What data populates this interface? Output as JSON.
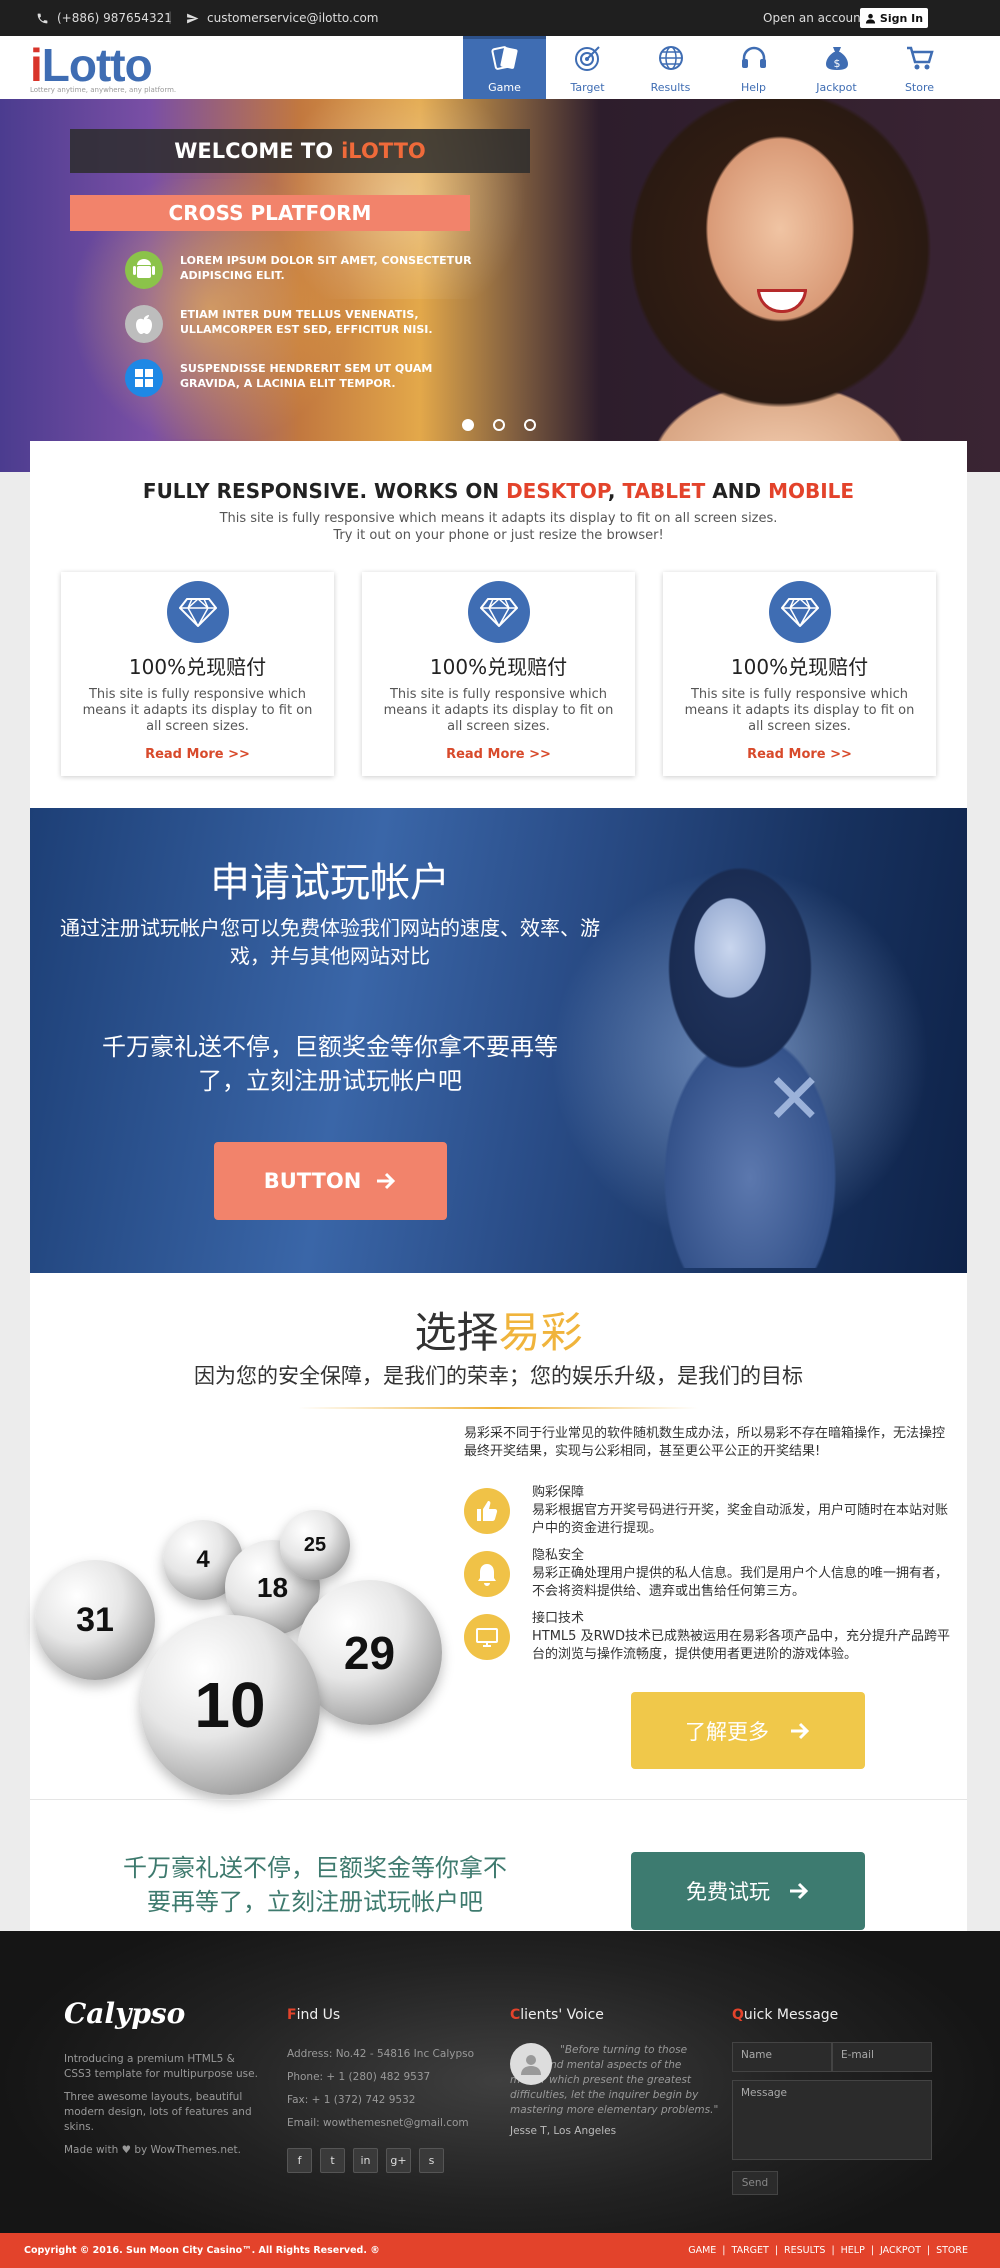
{
  "topbar": {
    "phone": "(+886) 987654321",
    "separator": "|",
    "email": "customerservice@ilotto.com",
    "open_account": "Open an account",
    "sign_in": "Sign In"
  },
  "logo": {
    "brand_i": "i",
    "brand_rest": "Lotto",
    "tagline": "Lottery anytime, anywhere, any platform."
  },
  "nav": [
    {
      "label": "Game",
      "icon": "cards-icon",
      "active": true
    },
    {
      "label": "Target",
      "icon": "target-icon"
    },
    {
      "label": "Results",
      "icon": "globe-icon"
    },
    {
      "label": "Help",
      "icon": "headset-icon"
    },
    {
      "label": "Jackpot",
      "icon": "money-bag-icon"
    },
    {
      "label": "Store",
      "icon": "cart-icon"
    }
  ],
  "hero": {
    "welcome_prefix": "WELCOME TO",
    "welcome_brand": "iLOTTO",
    "cross_platform": "CROSS PLATFORM",
    "features": [
      {
        "icon": "android-icon",
        "text": "LOREM IPSUM DOLOR SIT AMET, CONSECTETUR ADIPISCING ELIT."
      },
      {
        "icon": "apple-icon",
        "text": "ETIAM INTER DUM TELLUS VENENATIS, ULLAMCORPER EST SED, EFFICITUR NISI."
      },
      {
        "icon": "windows-icon",
        "text": "SUSPENDISSE HENDRERIT SEM UT QUAM GRAVIDA, A LACINIA ELIT TEMPOR."
      }
    ],
    "slides": 3,
    "active_slide": 1
  },
  "responsive": {
    "title_prefix": "FULLY RESPONSIVE. WORKS ON",
    "desktop": "DESKTOP",
    "comma": ",",
    "tablet": "TABLET",
    "and": "AND",
    "mobile": "MOBILE",
    "desc_line1": "This site is fully responsive which means it adapts its display to fit on all screen sizes.",
    "desc_line2": "Try it out on your phone or just resize the browser!",
    "cards": [
      {
        "title": "100%兑现赔付",
        "text": "This site is fully responsive which means it adapts its display to fit on all screen sizes.",
        "link": "Read More >>"
      },
      {
        "title": "100%兑现赔付",
        "text": "This site is fully responsive which means it adapts its display to fit on all screen sizes.",
        "link": "Read More >>"
      },
      {
        "title": "100%兑现赔付",
        "text": "This site is fully responsive which means it adapts its display to fit on all screen sizes.",
        "link": "Read More >>"
      }
    ]
  },
  "trial": {
    "title": "申请试玩帐户",
    "subtitle": "通过注册试玩帐户您可以免费体验我们网站的速度、效率、游戏，并与其他网站对比",
    "promo": "千万豪礼送不停，巨额奖金等你拿不要再等了，立刻注册试玩帐户吧",
    "button": "BUTTON"
  },
  "choose": {
    "title_prefix": "选择",
    "title_brand": "易彩",
    "subtitle": "因为您的安全保障，是我们的荣幸；您的娱乐升级，是我们的目标",
    "intro": "易彩采不同于行业常见的软件随机数生成办法，所以易彩不存在暗箱操作，无法操控最终开奖结果，实现与公彩相同，甚至更公平公正的开奖结果!",
    "features": [
      {
        "icon": "thumbs-up-icon",
        "title": "购彩保障",
        "text": "易彩根据官方开奖号码进行开奖，奖金自动派发，用户可随时在本站对账户中的资金进行提现。"
      },
      {
        "icon": "bell-icon",
        "title": "隐私安全",
        "text": "易彩正确处理用户提供的私人信息。我们是用户个人信息的唯一拥有者，不会将资料提供给、遗弃或出售给任何第三方。"
      },
      {
        "icon": "monitor-icon",
        "title": "接口技术",
        "text": "HTML5 及RWD技术已成熟被运用在易彩各项产品中，充分提升产品跨平台的浏览与操作流畅度，提供使用者更进阶的游戏体验。"
      }
    ],
    "balls": [
      "31",
      "4",
      "18",
      "25",
      "29",
      "10",
      "31"
    ],
    "button": "了解更多"
  },
  "bottom_cta": {
    "promo": "千万豪礼送不停，巨额奖金等你拿不要再等了，立刻注册试玩帐户吧",
    "button": "免费试玩"
  },
  "footer": {
    "brand": "Calypso",
    "about_1": "Introducing a premium HTML5 & CSS3 template for multipurpose use.",
    "about_2": "Three awesome layouts, beautiful modern design, lots of features and skins.",
    "made_with": "Made with",
    "made_by": "by WowThemes.net.",
    "find_first": "F",
    "find_rest": "ind Us",
    "address": "Address: No.42 - 54816 Inc Calypso",
    "phone": "Phone: + 1 (280) 482 9537",
    "fax": "Fax: + 1 (372) 742 9532",
    "email": "Email: wowthemesnet@gmail.com",
    "social": [
      "f",
      "t",
      "in",
      "g+",
      "s"
    ],
    "voice_first": "C",
    "voice_rest": "lients' Voice",
    "quote": "\"Before turning to those moral and mental aspects of the matter which present the greatest difficulties, let the inquirer begin by mastering more elementary problems.\"",
    "author": "Jesse T, Los Angeles",
    "quick_first": "Q",
    "quick_rest": "uick Message",
    "name_placeholder": "Name",
    "email_placeholder": "E-mail",
    "message_placeholder": "Message",
    "send": "Send"
  },
  "bottombar": {
    "copyright": "Copyright © 2016. Sun Moon City Casino™. All Rights Reserved. ®",
    "links": [
      "GAME",
      "TARGET",
      "RESULTS",
      "HELP",
      "JACKPOT",
      "STORE"
    ]
  },
  "colors": {
    "primary_blue": "#3f6db3",
    "accent_red": "#e3432b",
    "salmon": "#f2836b",
    "gold": "#f0c84a",
    "teal": "#3d7b70"
  }
}
